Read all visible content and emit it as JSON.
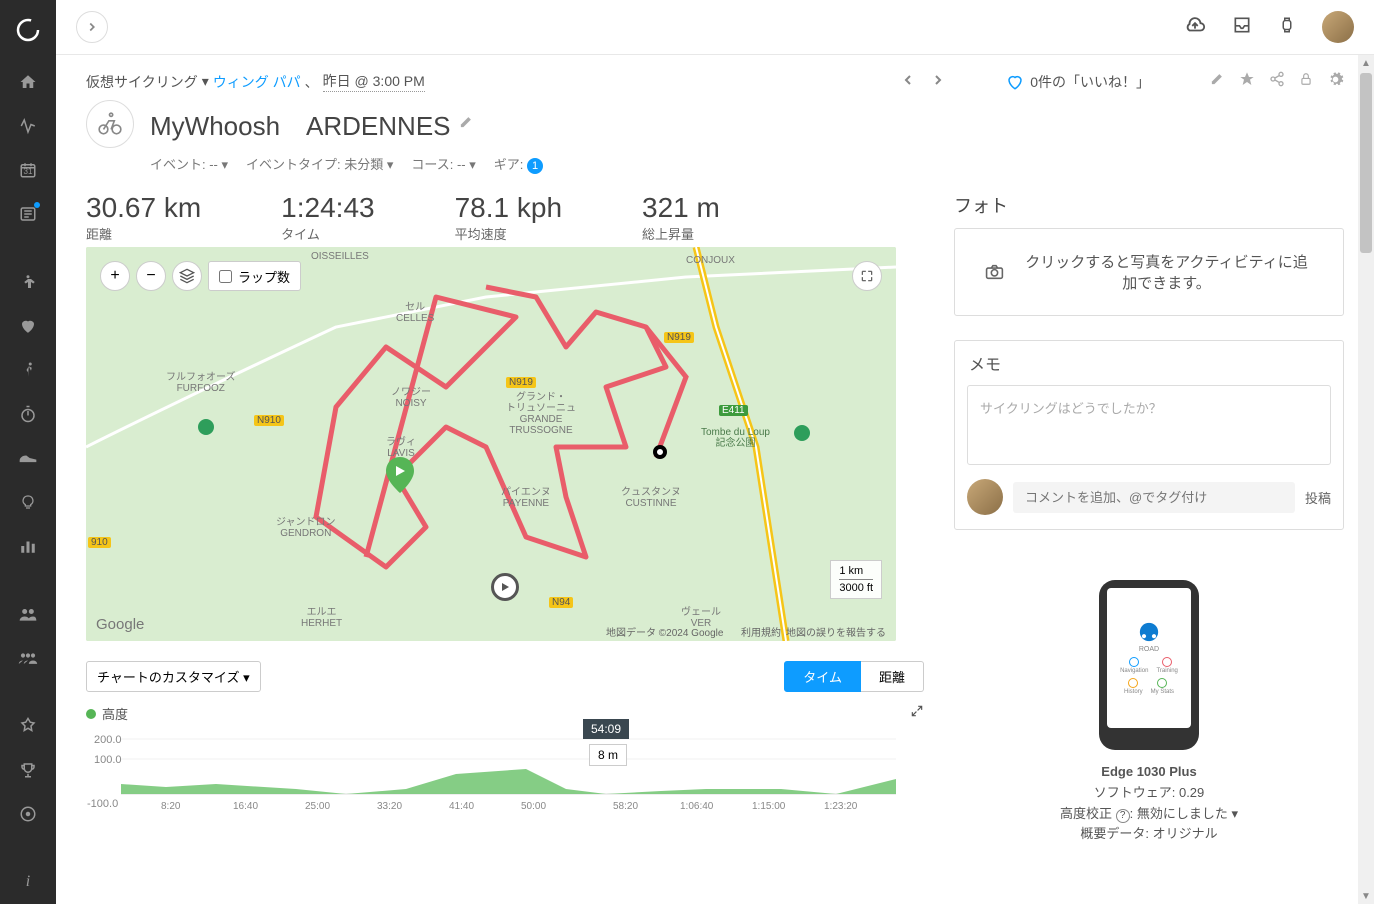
{
  "breadcrumb": {
    "activity_type": "仮想サイクリング",
    "user": "ウィング パパ",
    "timestamp": "昨日 @ 3:00 PM"
  },
  "title": "MyWhoosh　ARDENNES",
  "meta": {
    "event": "イベント: -- ▾",
    "event_type": "イベントタイプ: 未分類 ▾",
    "course": "コース: -- ▾",
    "gear": "ギア:",
    "gear_count": "1"
  },
  "likes": "0件の「いいね！」",
  "stats": {
    "distance": {
      "value": "30.67 km",
      "label": "距離"
    },
    "time": {
      "value": "1:24:43",
      "label": "タイム"
    },
    "avg_speed": {
      "value": "78.1 kph",
      "label": "平均速度"
    },
    "elevation": {
      "value": "321 m",
      "label": "総上昇量"
    }
  },
  "map": {
    "lap_label": "ラップ数",
    "scale_km": "1 km",
    "scale_ft": "3000 ft",
    "credit": "地図データ ©2024 Google",
    "terms": "利用規約",
    "report": "地図の誤りを報告する",
    "google": "Google",
    "places": {
      "conjoux": "CONJOUX",
      "furfooz": "フルフォオーズ\nFURFOOZ",
      "celles": "セル\nCELLES",
      "noisy": "ノワジー\nNOISY",
      "trussogne": "グランド・\nトリュソーニュ\nGRANDE\nTRUSSOGNE",
      "lavis": "ラヴィ\nLAVIS",
      "payenne": "パイエンヌ\nPAYENNE",
      "custinne": "クュスタンヌ\nCUSTINNE",
      "tombe": "Tombe du Loup\n記念公園",
      "gendron": "ジャンドロン\nGENDRON",
      "herhet": "エルエ\nHERHET",
      "ver": "ヴェール\nVER",
      "boisseilles": "OISSEILLES",
      "n919a": "N919",
      "n919b": "N919",
      "n910": "N910",
      "n910b": "910",
      "e411": "E411",
      "n94": "N94"
    }
  },
  "chart": {
    "customize": "チャートのカスタマイズ ▾",
    "tab_time": "タイム",
    "tab_dist": "距離",
    "altitude_legend": "高度",
    "tooltip_time": "54:09",
    "tooltip_val": "8 m"
  },
  "chart_data": {
    "type": "area",
    "title": "高度",
    "xlabel": "タイム",
    "ylabel": "高度 (m)",
    "y_ticks": [
      -100.0,
      100.0,
      200.0
    ],
    "x_ticks": [
      "8:20",
      "16:40",
      "25:00",
      "33:20",
      "41:40",
      "50:00",
      "58:20",
      "1:06:40",
      "1:15:00",
      "1:23:20"
    ],
    "ylim": [
      -100,
      200
    ],
    "series": [
      {
        "name": "高度",
        "color": "#56b556",
        "x": [
          "0:00",
          "8:20",
          "16:40",
          "25:00",
          "33:20",
          "41:40",
          "50:00",
          "54:09",
          "58:20",
          "1:06:40",
          "1:15:00",
          "1:23:20"
        ],
        "y": [
          20,
          5,
          10,
          -10,
          10,
          55,
          60,
          8,
          -5,
          5,
          -5,
          40
        ]
      }
    ],
    "hover_point": {
      "x": "54:09",
      "y": 8
    }
  },
  "photo": {
    "title": "フォト",
    "add_text": "クリックすると写真をアクティビティに追加できます。"
  },
  "memo": {
    "title": "メモ",
    "placeholder": "サイクリングはどうでしたか？"
  },
  "comment": {
    "placeholder": "コメントを追加、@でタグ付け",
    "submit": "投稿"
  },
  "device": {
    "name": "Edge 1030 Plus",
    "software": "ソフトウェア: 0.29",
    "calibration_label": "高度校正",
    "calibration_val": ": 無効にしました ▾",
    "data_src": "概要データ: オリジナル",
    "road": "ROAD",
    "nav": "Navigation",
    "training": "Training",
    "hist": "History",
    "stats": "My Stats"
  }
}
